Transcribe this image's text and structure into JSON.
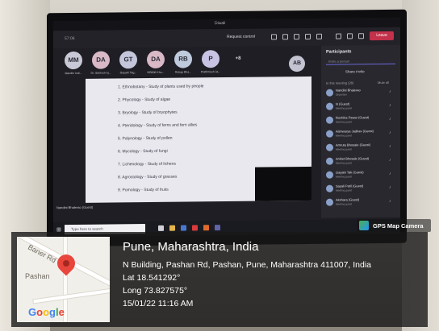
{
  "teams": {
    "meeting_title": "Diwali",
    "timer": "57:06",
    "request_control": "Request control",
    "leave_label": "Leave",
    "participants_strip": [
      {
        "initials": "MM",
        "name": "Mandle Indi...",
        "color": "#c9c8d6"
      },
      {
        "initials": "DA",
        "name": "Dr. Santosh Aj...",
        "color": "#d9b9c6"
      },
      {
        "initials": "GT",
        "name": "Gayatri Tag...",
        "color": "#c4c6db"
      },
      {
        "initials": "DA",
        "name": "BG000 Khu...",
        "color": "#d9b9c6"
      },
      {
        "initials": "RB",
        "name": "Rutuja Bha...",
        "color": "#bfcadd"
      },
      {
        "initials": "P",
        "name": "Prathmesh Ja...",
        "color": "#c8c3e4"
      }
    ],
    "more_count": "+8",
    "extra_avatar": "AB",
    "presenter_label": "Nandini Bhalerao (Guest)",
    "shared_lines": [
      "1. Ethnobotany      -  Study of plants used by people",
      "2. Phycology        -  Study of algae",
      "3. Bryology         -  Study of bryophytes",
      "4. Pteridology      -  Study of ferns and fern allies",
      "5. Palynology       -  Study of pollen",
      "6. Mycology         -  Study of fungi",
      "7. Lichenology      -  Study of lichens",
      "8. Agrostology      -  Study of grasses",
      "9. Pomology         -  Study of fruits"
    ]
  },
  "panel": {
    "title": "Participants",
    "search_placeholder": "Invite a person",
    "share_invite": "Share invite",
    "section_label": "In this meeting (28)",
    "mute_all": "Mute all",
    "people": [
      {
        "name": "Nandini Bhalerao",
        "role": "Organizer"
      },
      {
        "name": "N (Guest)",
        "role": "Meeting guest"
      },
      {
        "name": "Ruchika Pawar (Guest)",
        "role": "Meeting guest"
      },
      {
        "name": "Aishwarya Jadhav (Guest)",
        "role": "Meeting guest"
      },
      {
        "name": "Amruta Bhosale (Guest)",
        "role": "Meeting guest"
      },
      {
        "name": "Aniket Bhosale (Guest)",
        "role": "Meeting guest"
      },
      {
        "name": "Gayatri Tak (Guest)",
        "role": "Meeting guest"
      },
      {
        "name": "Sayali Patil (Guest)",
        "role": "Meeting guest"
      },
      {
        "name": "Akshara (Guest)",
        "role": "Meeting guest"
      }
    ]
  },
  "taskbar": {
    "search_placeholder": "Type here to search"
  },
  "gps_badge": "GPS Map Camera",
  "overlay": {
    "map_label_road": "Baner Rd",
    "map_label_area": "Pashan",
    "google_logo": "Google",
    "city": "Pune, Maharashtra, India",
    "address": "N Building, Pashan Rd, Pashan, Pune, Maharashtra 411007, India",
    "lat": "Lat 18.541292°",
    "long": "Long 73.827575°",
    "datetime": "15/01/22 11:16 AM"
  },
  "colors": {
    "teams_bg": "#1f1e24",
    "leave_red": "#c4314b",
    "pin_red": "#e8453c"
  }
}
